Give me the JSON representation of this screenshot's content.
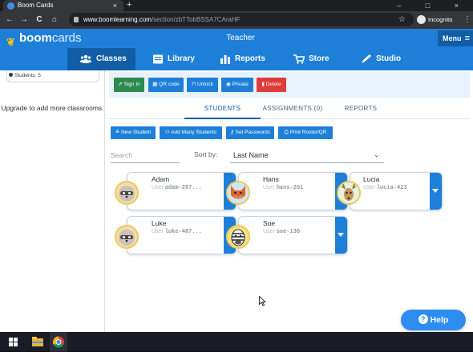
{
  "browser": {
    "tab_title": "Boom Cards",
    "tab_close": "×",
    "new_tab": "+",
    "window_controls": "– □ ×",
    "url_host": "www.boomlearning.com",
    "url_path": "/section/zbTTobBSSA7CAraHF",
    "incognito_label": "Incognito",
    "nav_back": "←",
    "nav_forward": "→",
    "nav_reload": "C",
    "nav_home": "⌂",
    "star": "☆",
    "kebab": "⋮"
  },
  "app": {
    "logo_bold": "boom",
    "logo_light": "cards",
    "role": "Teacher",
    "menu_label": "Menu",
    "menu_icon": "≡"
  },
  "nav": {
    "items": [
      {
        "label": "Classes",
        "icon": "people-icon"
      },
      {
        "label": "Library",
        "icon": "book-icon"
      },
      {
        "label": "Reports",
        "icon": "bar-chart-icon"
      },
      {
        "label": "Store",
        "icon": "cart-icon"
      },
      {
        "label": "Studio",
        "icon": "pen-icon"
      }
    ]
  },
  "sidebar": {
    "students_label": "Students: 5",
    "upgrade_text": "Upgrade to add more classrooms."
  },
  "actions": {
    "sign_in": "Sign In",
    "qr_code": "QR code",
    "unlock": "Unlock",
    "private": "Private",
    "delete": "Delete"
  },
  "tabs": {
    "students": "STUDENTS",
    "assignments": "ASSIGNMENTS (0)",
    "reports": "REPORTS"
  },
  "student_actions": {
    "new_student": "New Student",
    "add_many": "Add Many Students",
    "set_passwords": "Set Passwords",
    "print_roster": "Print Roster/QR"
  },
  "filters": {
    "search_placeholder": "Search",
    "sort_label": "Sort by:",
    "sort_value": "Last Name",
    "sort_chevron": "⌄"
  },
  "students": [
    {
      "name": "Adam",
      "user_prefix": "User",
      "username": "adam-287...",
      "avatar": "raccoon"
    },
    {
      "name": "Hans",
      "user_prefix": "User",
      "username": "hans-261",
      "avatar": "fox"
    },
    {
      "name": "Lucia",
      "user_prefix": "User",
      "username": "lucia-423",
      "avatar": "deer"
    },
    {
      "name": "Luke",
      "user_prefix": "User",
      "username": "luke-487...",
      "avatar": "raccoon"
    },
    {
      "name": "Sue",
      "user_prefix": "User",
      "username": "sue-136",
      "avatar": "zebra"
    }
  ],
  "help": {
    "label": "Help",
    "icon": "?"
  },
  "colors": {
    "brand_blue": "#1e7fd8",
    "nav_active": "#115ea6",
    "green": "#2c8a4e",
    "red": "#e03a3a"
  }
}
